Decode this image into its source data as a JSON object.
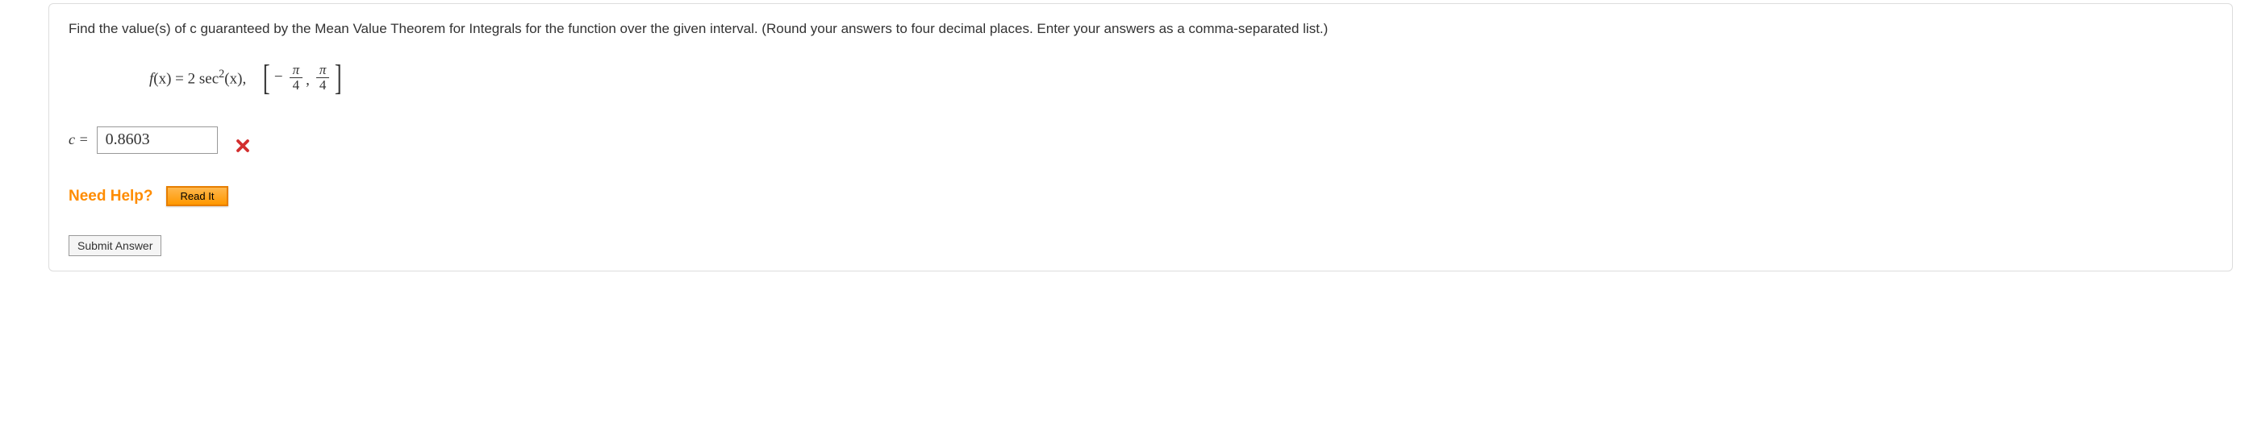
{
  "prompt": "Find the value(s) of c guaranteed by the Mean Value Theorem for Integrals for the function over the given interval. (Round your answers to four decimal places. Enter your answers as a comma-separated list.)",
  "formula": {
    "fx_part1": "f",
    "fx_part2": "(x) = 2 sec",
    "fx_exp": "2",
    "fx_part3": "(x),",
    "interval": {
      "neg": "−",
      "num1": "π",
      "den1": "4",
      "num2": "π",
      "den2": "4"
    }
  },
  "answer": {
    "label": "c =",
    "value": "0.8603"
  },
  "help": {
    "label": "Need Help?",
    "read_it": "Read It"
  },
  "submit": "Submit Answer"
}
